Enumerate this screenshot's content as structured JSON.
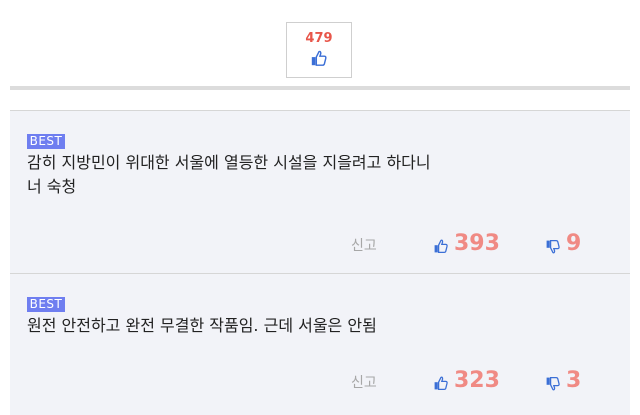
{
  "top_like": {
    "count": "479",
    "icon": "thumbs-up-icon"
  },
  "comments": [
    {
      "badge": "BEST",
      "line1": "감히 지방민이 위대한 서울에 열등한 시설을 지을려고 하다니",
      "line2": "너 숙청",
      "report_label": "신고",
      "upvotes": "393",
      "downvotes": "9"
    },
    {
      "badge": "BEST",
      "line1": "원전 안전하고 완전 무결한 작품임. 근데 서울은 안됨",
      "line2": "",
      "report_label": "신고",
      "upvotes": "323",
      "downvotes": "3"
    }
  ],
  "colors": {
    "badge": "#6f7ef0",
    "vote": "#f08a84",
    "like_count": "#e8564a",
    "icon_blue": "#3b6fd6"
  }
}
